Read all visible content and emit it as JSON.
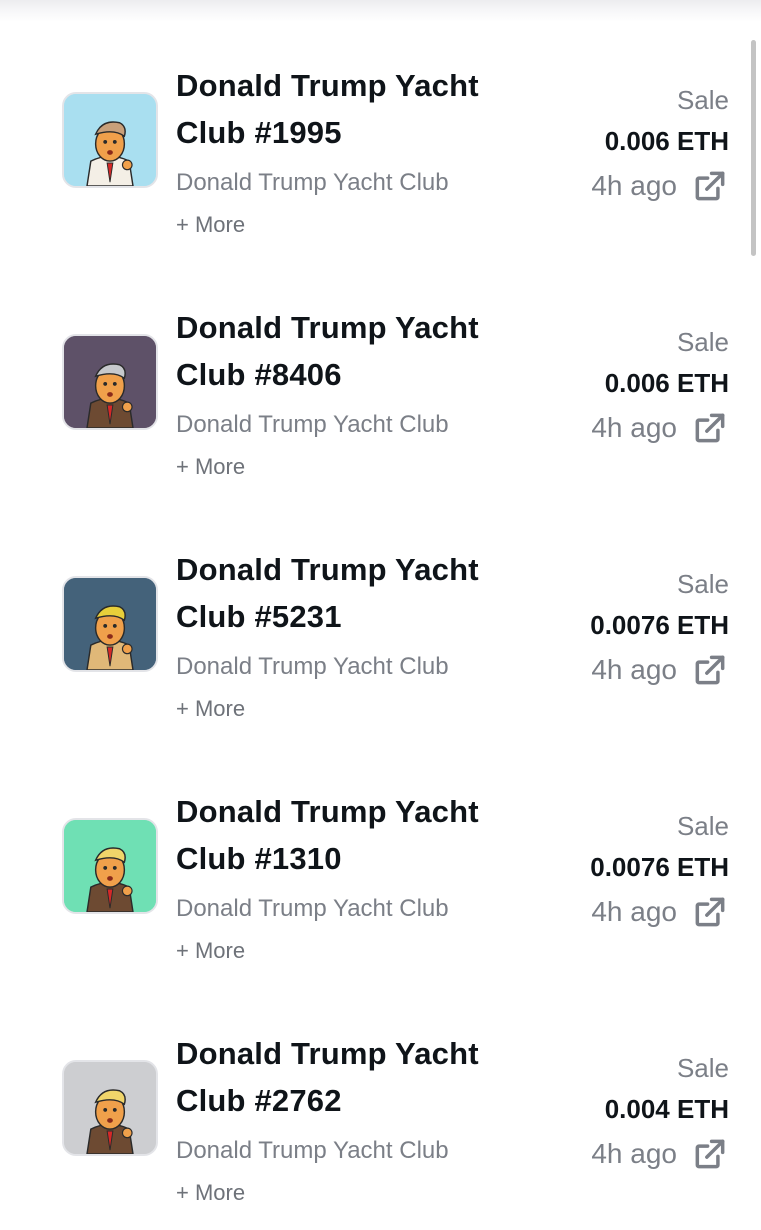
{
  "activity": {
    "items": [
      {
        "title": "Donald Trump Yacht Club #1995",
        "collection": "Donald Trump Yacht Club",
        "more_label": "+ More",
        "event_type": "Sale",
        "price": "0.006 ETH",
        "time": "4h ago",
        "thumb_bg": "#a9dff0",
        "hat_color": "#c9a07a",
        "jacket_color": "#f4efe6",
        "external_icon": "external-link-icon"
      },
      {
        "title": "Donald Trump Yacht Club #8406",
        "collection": "Donald Trump Yacht Club",
        "more_label": "+ More",
        "event_type": "Sale",
        "price": "0.006 ETH",
        "time": "4h ago",
        "thumb_bg": "#5e5168",
        "hat_color": "#c7c9cc",
        "jacket_color": "#6d4a32",
        "external_icon": "external-link-icon"
      },
      {
        "title": "Donald Trump Yacht Club #5231",
        "collection": "Donald Trump Yacht Club",
        "more_label": "+ More",
        "event_type": "Sale",
        "price": "0.0076 ETH",
        "time": "4h ago",
        "thumb_bg": "#44627a",
        "hat_color": "#e8cf3a",
        "jacket_color": "#e0b878",
        "external_icon": "external-link-icon"
      },
      {
        "title": "Donald Trump Yacht Club #1310",
        "collection": "Donald Trump Yacht Club",
        "more_label": "+ More",
        "event_type": "Sale",
        "price": "0.0076 ETH",
        "time": "4h ago",
        "thumb_bg": "#6fe0b4",
        "hat_color": "#f0d56a",
        "jacket_color": "#6d4a32",
        "external_icon": "external-link-icon"
      },
      {
        "title": "Donald Trump Yacht Club #2762",
        "collection": "Donald Trump Yacht Club",
        "more_label": "+ More",
        "event_type": "Sale",
        "price": "0.004 ETH",
        "time": "4h ago",
        "thumb_bg": "#cdced1",
        "hat_color": "#f0d56a",
        "jacket_color": "#6d4a32",
        "external_icon": "external-link-icon"
      }
    ]
  },
  "colors": {
    "title": "#0f1419",
    "muted": "#7b7f87",
    "icon": "#7b7f87"
  }
}
